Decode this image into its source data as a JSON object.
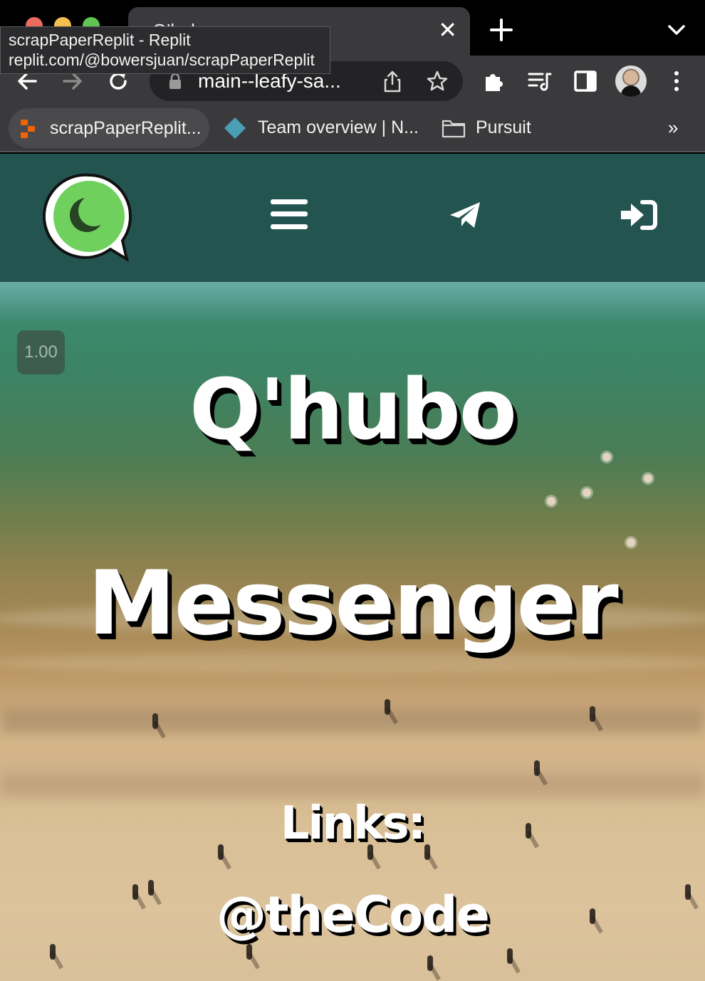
{
  "browser": {
    "tab_title": "Q'hubo",
    "tab_close": "✕",
    "tooltip_line1": "scrapPaperReplit - Replit",
    "tooltip_line2": "replit.com/@bowersjuan/scrapPaperReplit",
    "address": "main--leafy-sa...",
    "bookmarks": [
      {
        "label": "scrapPaperReplit...",
        "icon": "replit-icon"
      },
      {
        "label": "Team overview | N...",
        "icon": "diamond-icon"
      },
      {
        "label": "Pursuit",
        "icon": "folder-icon"
      }
    ],
    "bookmarks_more": "»"
  },
  "header": {
    "logo": "qhubo-chat-bubble-logo",
    "menu_icon": "hamburger-icon",
    "send_icon": "paper-plane-icon",
    "login_icon": "sign-in-icon",
    "background_color": "#235450",
    "logo_green": "#6fd05e"
  },
  "hero": {
    "speed_badge": "1.00",
    "title": "Q'hubo",
    "subtitle": "Messenger",
    "links_label": "Links:",
    "handle": "@theCode"
  }
}
